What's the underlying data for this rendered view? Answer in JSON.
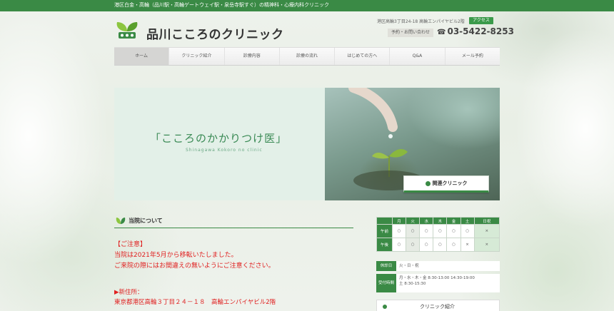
{
  "topbar": {
    "text": "港区白金・高輪（品川駅・高輪ゲートウェイ駅・泉岳寺駅すぐ）の精神科・心療内科クリニック"
  },
  "header": {
    "site_title": "品川こころのクリニック",
    "address": "港区高輪3丁目24-18 高輪エンパイヤビル2階",
    "access_label": "アクセス",
    "yoyaku_label": "予約・お問い合わせ",
    "phone": "03-5422-8253"
  },
  "nav": {
    "items": [
      "ホーム",
      "クリニック紹介",
      "診療内容",
      "診療の流れ",
      "はじめての方へ",
      "Q&A",
      "メール予約"
    ]
  },
  "hero": {
    "title": "「こころのかかりつけ医」",
    "subtitle": "Shinagawa Kokoro no clinic",
    "button_label": "関連クリニック"
  },
  "about": {
    "heading": "当院について",
    "notice_lines": [
      "【ご注意】",
      "当院は2021年5月から移転いたしました。",
      "ご来院の際にはお間違えの無いようにご注意ください。"
    ],
    "new_address_lines": [
      "▶新住所：",
      "東京都港区高輪３丁目２４－１８　高輪エンパイヤビル2階"
    ]
  },
  "schedule": {
    "headers": [
      "",
      "月",
      "火",
      "水",
      "木",
      "金",
      "土",
      "日祝"
    ],
    "rows": [
      {
        "label": "午前",
        "cells": [
          "○",
          "○",
          "○",
          "○",
          "○",
          "○",
          "×"
        ]
      },
      {
        "label": "午後",
        "cells": [
          "○",
          "○",
          "○",
          "○",
          "○",
          "×",
          "×"
        ]
      }
    ],
    "closed_label": "休診日",
    "closed_value": "火・日・祝",
    "hours_label": "受付時間",
    "hours_lines": [
      "月・水・木・金 8:30-13:00 14:30-19:00",
      "土 8:30-15:30"
    ]
  },
  "sidebar": {
    "clinic_intro": "クリニック紹介"
  },
  "colors": {
    "brand_green": "#3a8a45",
    "notice_red": "#e02020"
  }
}
